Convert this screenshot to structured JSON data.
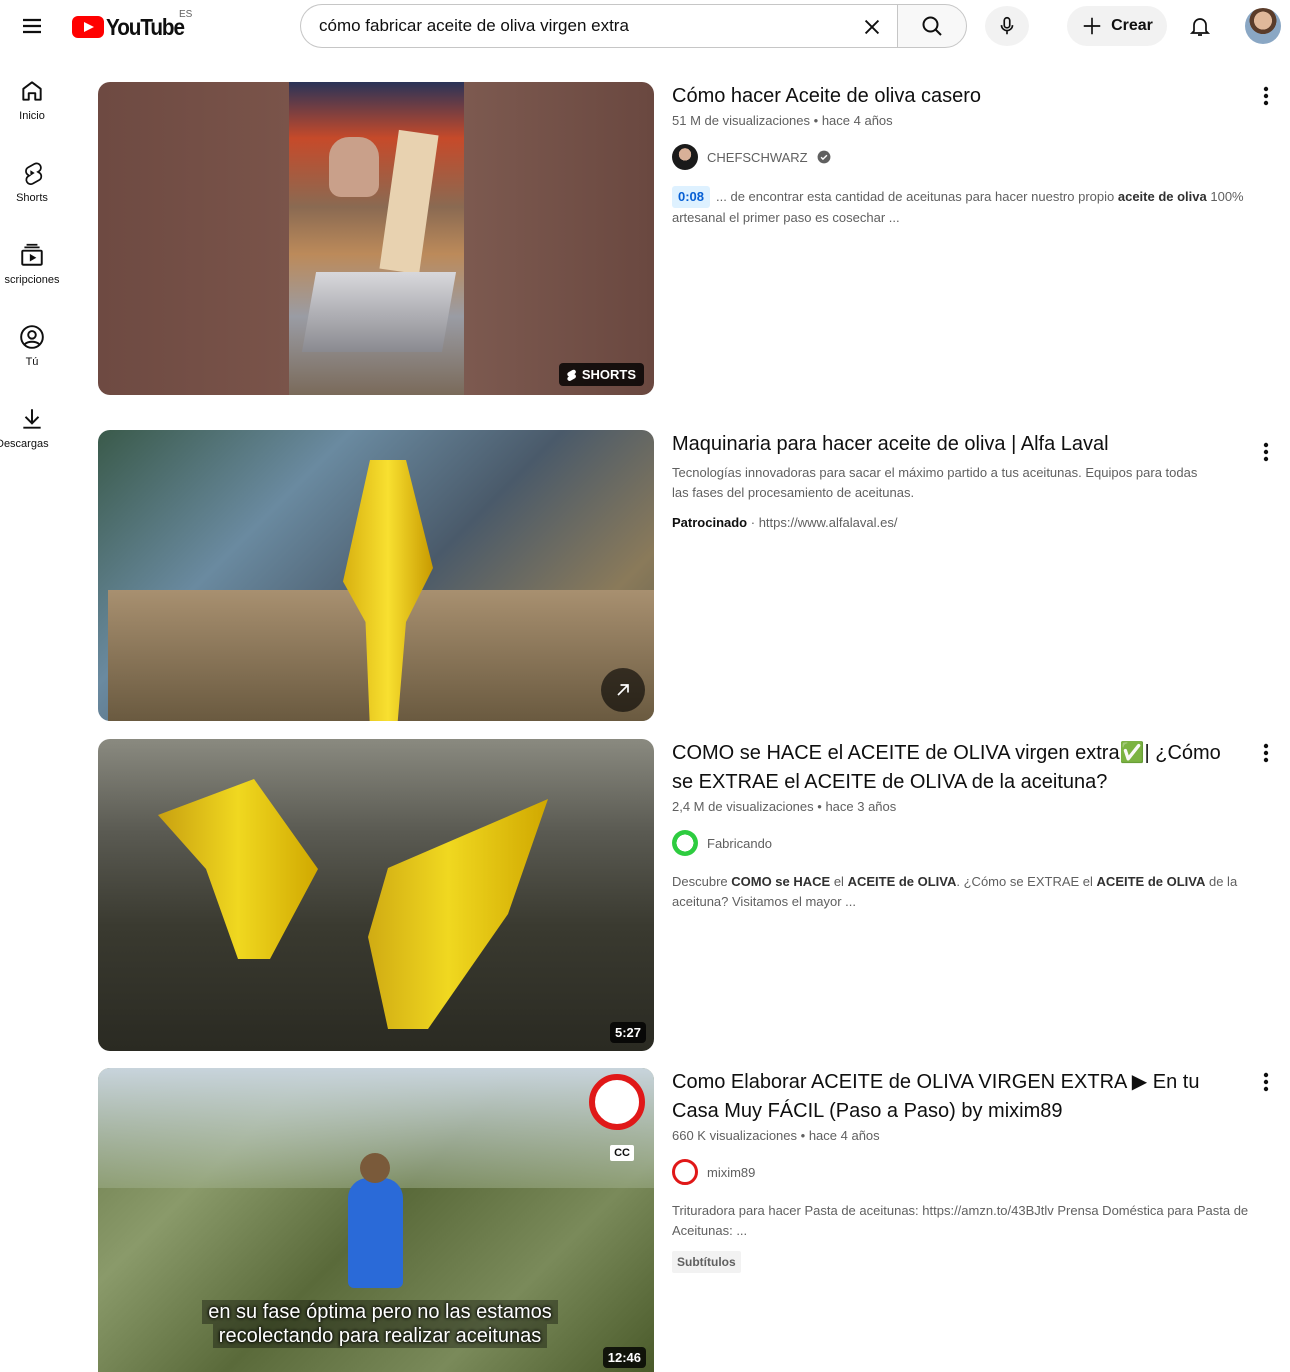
{
  "header": {
    "logo_text": "YouTube",
    "country_code": "ES",
    "search_value": "cómo fabricar aceite de oliva virgen extra",
    "create_label": "Crear"
  },
  "sidebar": {
    "items": [
      {
        "label": "Inicio",
        "icon": "home-icon"
      },
      {
        "label": "Shorts",
        "icon": "shorts-icon"
      },
      {
        "label": "scripciones",
        "icon": "subscriptions-icon"
      },
      {
        "label": "Tú",
        "icon": "you-icon"
      },
      {
        "label": "Descargas",
        "icon": "download-icon"
      }
    ]
  },
  "results": [
    {
      "title": "Cómo hacer Aceite de oliva casero",
      "views": "51 M de visualizaciones",
      "age": "hace 4 años",
      "channel": "CHEFSCHWARZ",
      "verified": true,
      "timestamp": "0:08",
      "snippet_1": "... de encontrar esta cantidad de aceitunas para hacer nuestro propio ",
      "snippet_bold": "aceite de oliva",
      "snippet_2": " 100% artesanal el primer paso es cosechar ...",
      "badge": "SHORTS"
    },
    {
      "title": "Maquinaria para hacer aceite de oliva | Alfa Laval",
      "description": "Tecnologías innovadoras para sacar el máximo partido a tus aceitunas. Equipos para todas las fases del procesamiento de aceitunas.",
      "sponsored_label": "Patrocinado",
      "url": "https://www.alfalaval.es/"
    },
    {
      "title": "COMO se HACE el ACEITE de OLIVA virgen extra✅| ¿Cómo se EXTRAE el ACEITE de OLIVA de la aceituna?",
      "views": "2,4 M de visualizaciones",
      "age": "hace 3 años",
      "channel": "Fabricando",
      "duration": "5:27",
      "desc_parts": [
        "Descubre ",
        "COMO se HACE",
        " el ",
        "ACEITE de OLIVA",
        ". ¿Cómo se EXTRAE el ",
        "ACEITE de OLIVA",
        " de la aceituna? Visitamos el mayor ..."
      ]
    },
    {
      "title": "Como Elaborar ACEITE de OLIVA VIRGEN EXTRA ▶ En tu Casa Muy FÁCIL (Paso a Paso) by mixim89",
      "views": "660 K visualizaciones",
      "age": "hace 4 años",
      "channel": "mixim89",
      "duration": "12:46",
      "description": "Trituradora para hacer Pasta de aceitunas: https://amzn.to/43BJtlv Prensa Doméstica para Pasta de Aceitunas: ...",
      "chip": "Subtítulos",
      "cc_label": "CC",
      "caption_line1": "en su fase óptima pero no las estamos",
      "caption_line2": "recolectando para realizar aceitunas"
    }
  ],
  "colors": {
    "brand_red": "#ff0000",
    "link_blue": "#065fd4",
    "meta_gray": "#606060"
  }
}
